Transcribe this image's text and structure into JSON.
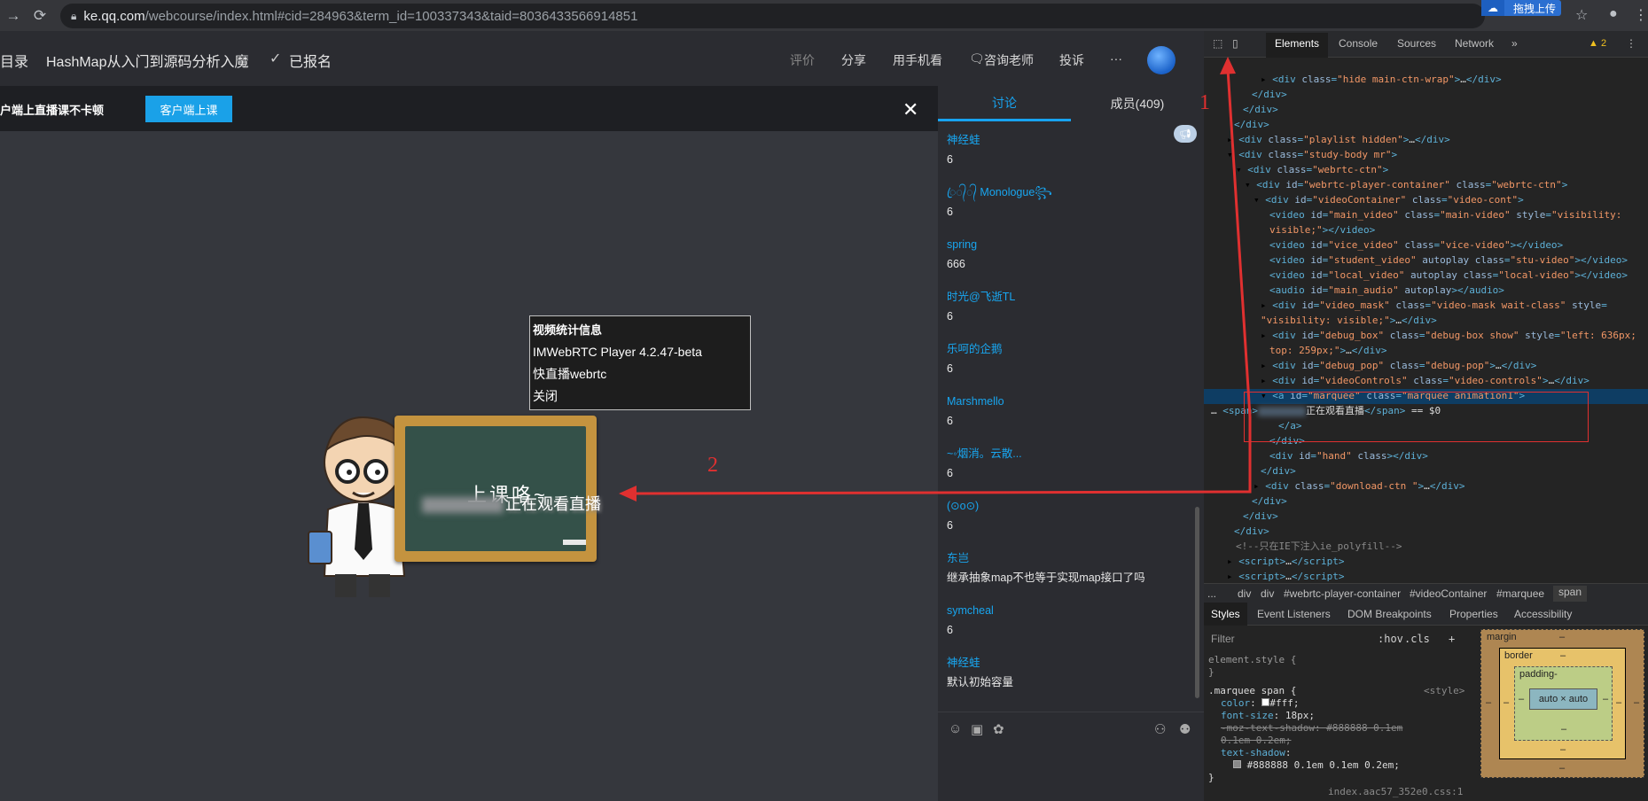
{
  "browser": {
    "url_host": "ke.qq.com",
    "url_path": "/webcourse/index.html#cid=284963&term_id=100337343&taid=8036433566914851",
    "extension_label": "拖拽上传"
  },
  "course_header": {
    "directory": "目录",
    "title": "HashMap从入门到源码分析入魔",
    "enrolled": "已报名",
    "actions": [
      "评价",
      "分享",
      "用手机看",
      "咨询老师",
      "投诉",
      "···"
    ]
  },
  "banner": {
    "text": "户端上直播课不卡顿",
    "button": "客户端上课",
    "close": "✕"
  },
  "video": {
    "debug_pop": [
      "视频统计信息",
      "IMWebRTC Player 4.2.47-beta",
      "快直播webrtc",
      "关闭"
    ],
    "board_text": "上课咯~",
    "marquee_text": "正在观看直播"
  },
  "chat": {
    "tabs": [
      "讨论",
      "成员(409)"
    ],
    "messages": [
      {
        "user": "神经蛙",
        "text": "6"
      },
      {
        "user": "ꦿ᭄᭄ Monologue꧂",
        "text": "6"
      },
      {
        "user": "spring",
        "text": "666"
      },
      {
        "user": "时光@飞逝TL",
        "text": "6"
      },
      {
        "user": "乐呵的企鹅",
        "text": "6"
      },
      {
        "user": "Marshmello",
        "text": "6"
      },
      {
        "user": "~◦烟消。云散...",
        "text": "6"
      },
      {
        "user": "(⊙o⊙)",
        "text": "6"
      },
      {
        "user": "东岂",
        "text": "继承抽象map不也等于实现map接口了吗"
      },
      {
        "user": "symcheal",
        "text": "6"
      },
      {
        "user": "神经蛙",
        "text": "默认初始容量"
      }
    ]
  },
  "devtools": {
    "tabs": [
      "Elements",
      "Console",
      "Sources",
      "Network",
      "»"
    ],
    "warnings": "2",
    "breadcrumbs": [
      "...",
      "div",
      "div",
      "#webrtc-player-container",
      "#videoContainer",
      "#marquee",
      "span"
    ],
    "style_tabs": [
      "Styles",
      "Event Listeners",
      "DOM Breakpoints",
      "Properties",
      "Accessibility"
    ],
    "filter_placeholder": "Filter",
    "filter_hov": ":hov",
    "filter_cls": ".cls",
    "element_style": "element.style {",
    "element_style_close": "}",
    "rule_selector": ".marquee span {",
    "rule_source": "<style>",
    "rule_color": "#fff;",
    "rule_font_size": "18px;",
    "rule_moz": "-moz-text-shadow: #888888 0.1em 0.1em 0.2em;",
    "rule_shadow_value": "#888888 0.1em 0.1em 0.2em;",
    "rule_close": "}",
    "source_file": "index.aac57_352e0.css:1",
    "box_model": {
      "margin": "margin",
      "border": "border",
      "padding": "padding-",
      "content": "auto × auto",
      "dash": "–"
    }
  },
  "annotations": {
    "label_1": "1",
    "label_2": "2"
  },
  "colors": {
    "accent": "#1aa1e8",
    "annotation": "#e03030",
    "selected_row": "#0e3d63"
  }
}
